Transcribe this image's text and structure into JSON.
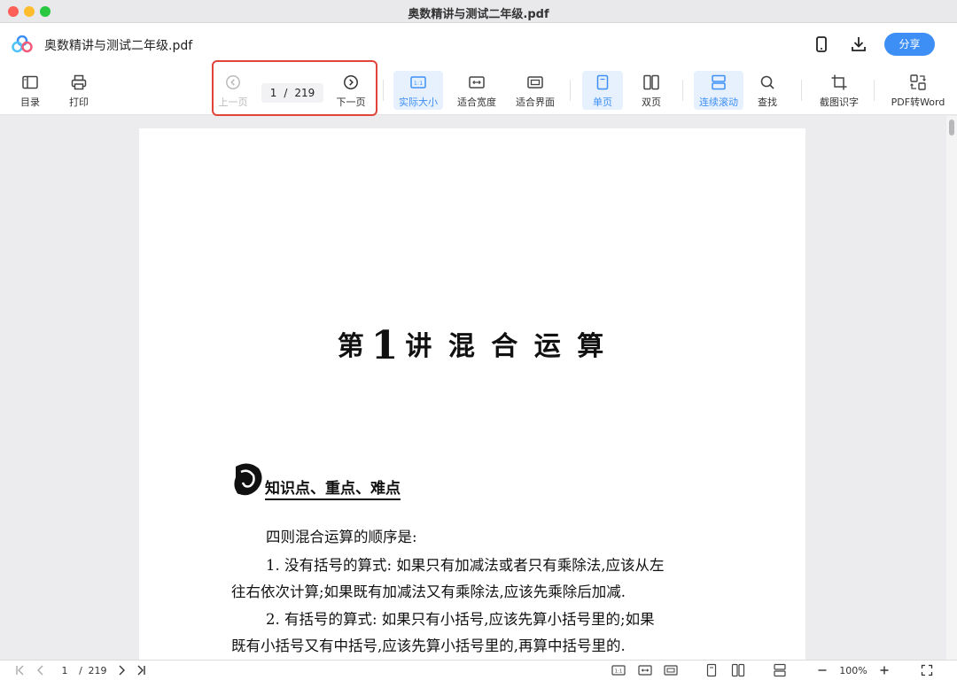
{
  "window": {
    "title": "奥数精讲与测试二年级.pdf"
  },
  "header": {
    "doc_title": "奥数精讲与测试二年级.pdf",
    "share_label": "分享"
  },
  "toolbar": {
    "toc": "目录",
    "print": "打印",
    "prev_page": "上一页",
    "next_page": "下一页",
    "current_page": "1",
    "page_sep": "/",
    "total_pages": "219",
    "actual_size": "实际大小",
    "fit_width": "适合宽度",
    "fit_page": "适合界面",
    "single_page": "单页",
    "double_page": "双页",
    "continuous": "连续滚动",
    "find": "查找",
    "ocr": "截图识字",
    "pdf_to_word": "PDF转Word",
    "actual_size_icon": "1:1"
  },
  "document": {
    "chapter_prefix": "第",
    "chapter_num": "1",
    "chapter_suffix": "讲  混 合 运 算",
    "section_title": "知识点、重点、难点",
    "lines": [
      "四则混合运算的顺序是:",
      "1. 没有括号的算式: 如果只有加减法或者只有乘除法,应该从左",
      "往右依次计算;如果既有加减法又有乘除法,应该先乘除后加减.",
      "2. 有括号的算式: 如果只有小括号,应该先算小括号里的;如果",
      "既有小括号又有中括号,应该先算小括号里的,再算中括号里的."
    ]
  },
  "statusbar": {
    "current_page": "1",
    "page_sep": "/",
    "total_pages": "219",
    "zoom": "100%",
    "actual_size_icon": "1:1"
  },
  "colors": {
    "accent": "#3d8ff5",
    "highlight": "#e0443a"
  }
}
